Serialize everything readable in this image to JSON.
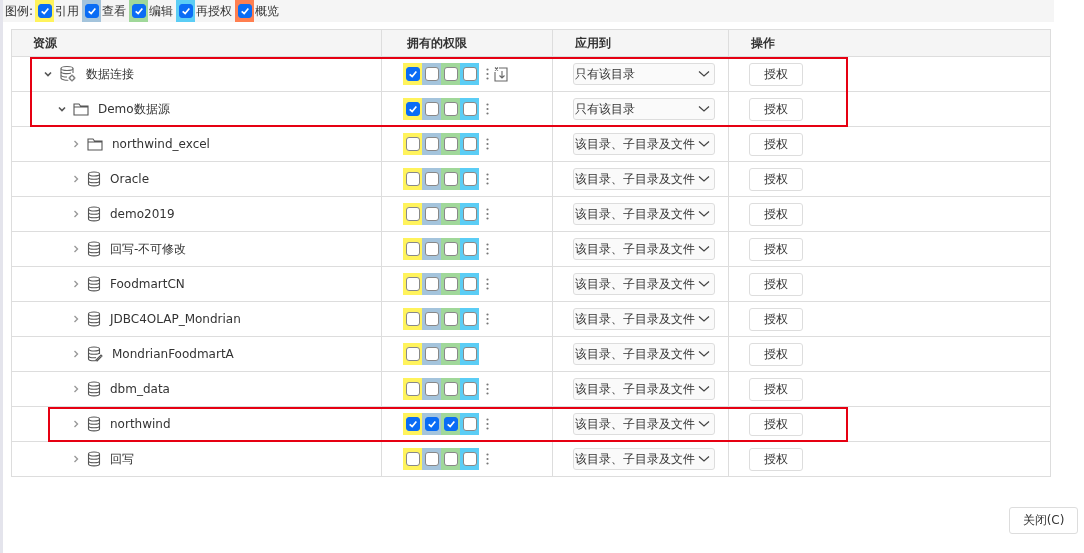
{
  "legend": {
    "label": "图例:",
    "items": [
      {
        "label": "引用",
        "color": "#fff35c",
        "checked": true
      },
      {
        "label": "查看",
        "color": "#a4c4dc",
        "checked": true
      },
      {
        "label": "编辑",
        "color": "#a0d89a",
        "checked": true
      },
      {
        "label": "再授权",
        "color": "#5bcdf5",
        "checked": true
      },
      {
        "label": "概览",
        "color": "#ff7f50",
        "checked": true
      }
    ]
  },
  "table": {
    "columns": [
      "资源",
      "拥有的权限",
      "应用到",
      "操作"
    ],
    "rows": [
      {
        "name": "数据连接",
        "kind": "connection",
        "expanded": true,
        "perms": [
          true,
          false,
          false,
          false
        ],
        "more": true,
        "import": true,
        "scope": "只有该目录",
        "action": "授权",
        "highlighted": true,
        "children": [
          {
            "name": "Demo数据源",
            "kind": "folder",
            "expanded": true,
            "perms": [
              true,
              false,
              false,
              false
            ],
            "more": true,
            "scope": "只有该目录",
            "action": "授权",
            "highlighted": true,
            "children": [
              {
                "name": "northwind_excel",
                "kind": "folder",
                "expanded": false,
                "perms": [
                  false,
                  false,
                  false,
                  false
                ],
                "more": true,
                "scope": "该目录、子目录及文件",
                "action": "授权",
                "highlighted": false
              },
              {
                "name": "Oracle",
                "kind": "database",
                "expanded": false,
                "perms": [
                  false,
                  false,
                  false,
                  false
                ],
                "more": true,
                "scope": "该目录、子目录及文件",
                "action": "授权",
                "highlighted": false
              },
              {
                "name": "demo2019",
                "kind": "database",
                "expanded": false,
                "perms": [
                  false,
                  false,
                  false,
                  false
                ],
                "more": true,
                "scope": "该目录、子目录及文件",
                "action": "授权",
                "highlighted": false
              },
              {
                "name": "回写-不可修改",
                "kind": "database",
                "expanded": false,
                "perms": [
                  false,
                  false,
                  false,
                  false
                ],
                "more": true,
                "scope": "该目录、子目录及文件",
                "action": "授权",
                "highlighted": false
              },
              {
                "name": "FoodmartCN",
                "kind": "database",
                "expanded": false,
                "perms": [
                  false,
                  false,
                  false,
                  false
                ],
                "more": true,
                "scope": "该目录、子目录及文件",
                "action": "授权",
                "highlighted": false
              },
              {
                "name": "JDBC4OLAP_Mondrian",
                "kind": "database",
                "expanded": false,
                "perms": [
                  false,
                  false,
                  false,
                  false
                ],
                "more": true,
                "scope": "该目录、子目录及文件",
                "action": "授权",
                "highlighted": false
              },
              {
                "name": "MondrianFoodmartA",
                "kind": "database-edit",
                "expanded": false,
                "perms": [
                  false,
                  false,
                  false,
                  false
                ],
                "more": false,
                "scope": "该目录、子目录及文件",
                "action": "授权",
                "highlighted": false
              },
              {
                "name": "dbm_data",
                "kind": "database",
                "expanded": false,
                "perms": [
                  false,
                  false,
                  false,
                  false
                ],
                "more": true,
                "scope": "该目录、子目录及文件",
                "action": "授权",
                "highlighted": false
              },
              {
                "name": "northwind",
                "kind": "database",
                "expanded": false,
                "perms": [
                  true,
                  true,
                  true,
                  false
                ],
                "more": true,
                "scope": "该目录、子目录及文件",
                "action": "授权",
                "highlighted": true
              },
              {
                "name": "回写",
                "kind": "database",
                "expanded": false,
                "perms": [
                  false,
                  false,
                  false,
                  false
                ],
                "more": true,
                "scope": "该目录、子目录及文件",
                "action": "授权",
                "highlighted": false
              }
            ]
          }
        ]
      }
    ]
  },
  "close_button": "关闭(C)"
}
